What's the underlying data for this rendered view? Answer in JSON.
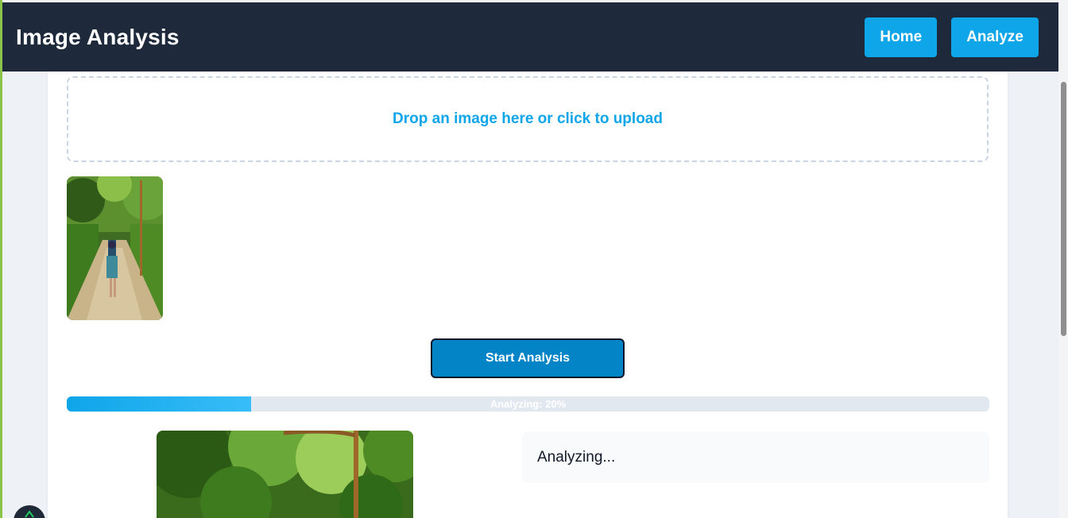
{
  "header": {
    "title": "Image Analysis",
    "nav": [
      {
        "label": "Home"
      },
      {
        "label": "Analyze"
      }
    ]
  },
  "upload": {
    "prompt": "Drop an image here or click to upload"
  },
  "actions": {
    "start_label": "Start Analysis"
  },
  "progress": {
    "value": 0.2,
    "label": "Analyzing: 20%"
  },
  "result": {
    "status_text": "Analyzing..."
  },
  "colors": {
    "header_bg": "#1e293b",
    "accent": "#0ea5e9",
    "start_button": "#0284c7"
  },
  "icons": {
    "floating_button": "leaf-icon"
  }
}
